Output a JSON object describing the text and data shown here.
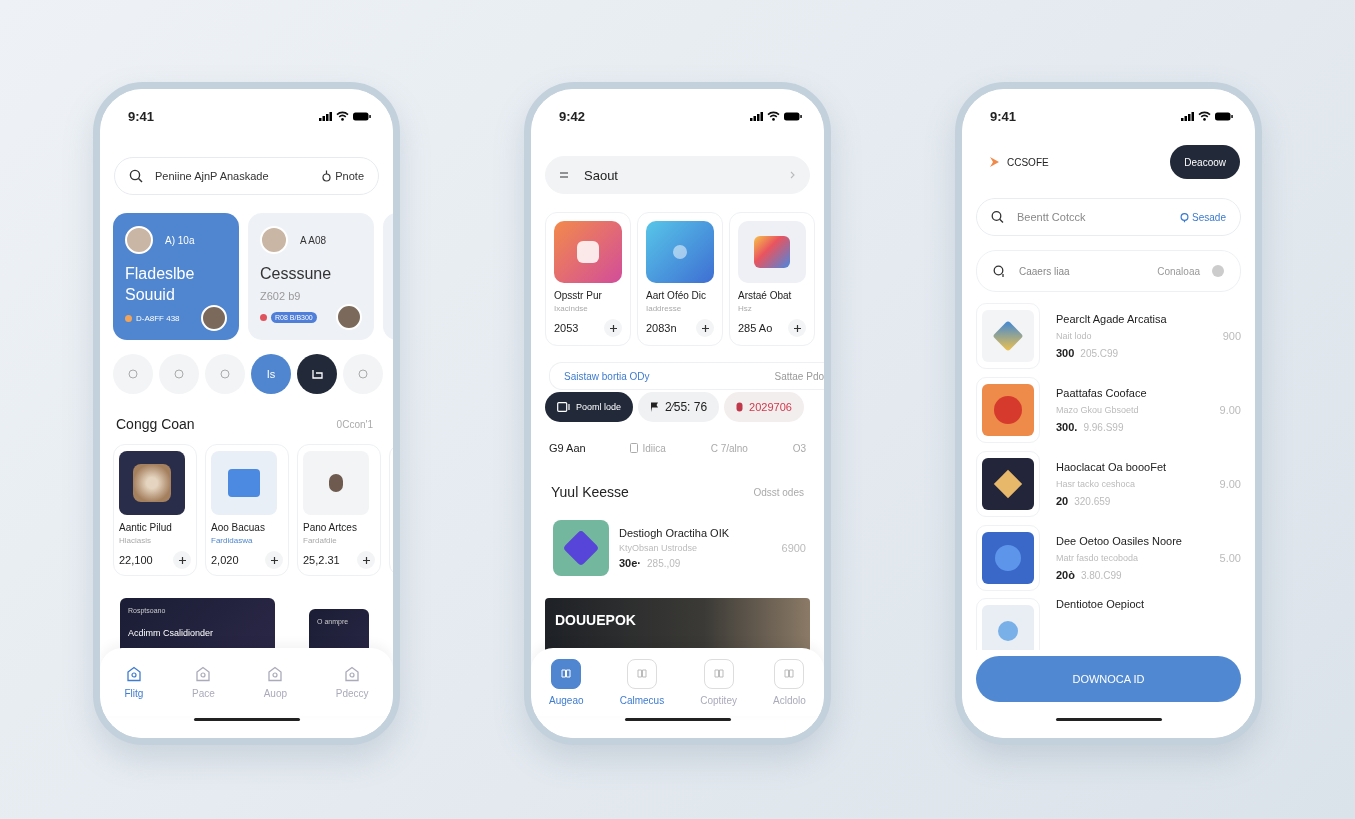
{
  "left_phone": {
    "time": "9:41",
    "search": {
      "placeholder": "Peniine AjnP Anaskade",
      "action": "Pnote"
    },
    "featured": [
      {
        "meta": "A) 10a",
        "title": "Fladeslbe Souuid",
        "footer": "D-A8FF 438",
        "selected": true
      },
      {
        "meta": "A A08",
        "title": "Cesssune",
        "subtitle": "Z602 b9",
        "tag": "R08 B/B300",
        "selected": false
      }
    ],
    "chips": [
      {
        "kind": "plain"
      },
      {
        "kind": "plain"
      },
      {
        "kind": "plain"
      },
      {
        "kind": "accent",
        "label": "Is"
      },
      {
        "kind": "dark"
      },
      {
        "kind": "plain"
      }
    ],
    "section": {
      "title": "Congg Coan",
      "link": "0Ccon'1"
    },
    "products": [
      {
        "name": "Aantic Pilud",
        "subtitle": "Hlaciasis",
        "price": "22,100",
        "highlighted": false
      },
      {
        "name": "Aoo Bacuas",
        "subtitle": "Fardidaswa",
        "price": "2,020",
        "highlighted": true
      },
      {
        "name": "Pano Artces",
        "subtitle": "Fardafdie",
        "price": "25,2.31",
        "highlighted": false
      }
    ],
    "banners": [
      {
        "kicker": "Rosptsoano",
        "title": "Acdimm Csalidionder"
      },
      {
        "kicker": "O anmpre"
      }
    ],
    "nav": [
      {
        "label": "Flitg",
        "selected": true
      },
      {
        "label": "Pace",
        "selected": false
      },
      {
        "label": "Auop",
        "selected": false
      },
      {
        "label": "Pdeccy",
        "selected": false
      }
    ]
  },
  "middle_phone": {
    "time": "9:42",
    "search": {
      "value": "Saout"
    },
    "apps": [
      {
        "name": "Opsstr Pur",
        "subtitle": "Ixacindse",
        "price": "2053"
      },
      {
        "name": "Aart Oféo Dic",
        "subtitle": "Iaddresse",
        "price": "2083n"
      },
      {
        "name": "Arstaé Obat",
        "subtitle": "Hsz",
        "price": "285 Ao"
      }
    ],
    "tabs": [
      {
        "label": "Saistaw bortia ODy",
        "selected": true
      },
      {
        "label": "Sattae Pdo",
        "selected": false
      }
    ],
    "chips": [
      {
        "label": "Pooml lode",
        "kind": "dark"
      },
      {
        "label": "2⁄55: 76",
        "kind": "light"
      },
      {
        "label": "2029706",
        "kind": "alert"
      }
    ],
    "stats": [
      {
        "label": "G9 Aan",
        "kind": "strong"
      },
      {
        "label": "Idiica",
        "kind": "icon"
      },
      {
        "label": "C 7/alno",
        "kind": "plain"
      },
      {
        "label": "O3",
        "kind": "plain"
      }
    ],
    "section": {
      "title": "Yuul Keesse",
      "link": "Odsst odes"
    },
    "item": {
      "title": "Destiogh Oractiha OIK",
      "subtitle": "KtyObsan Ustrodse",
      "count": "30e·",
      "price": "285.,09",
      "amount": "6900"
    },
    "banner": {
      "title": "DOUUEPOK"
    },
    "nav": [
      {
        "label": "Augeao",
        "selected": true,
        "highlighted": false
      },
      {
        "label": "Calmecus",
        "selected": false,
        "highlighted": true
      },
      {
        "label": "Coptitey",
        "selected": false,
        "highlighted": false
      },
      {
        "label": "Acldolo",
        "selected": false,
        "highlighted": false
      }
    ]
  },
  "right_phone": {
    "time": "9:41",
    "brand": "CCSOFE",
    "header_button": "Deacoow",
    "search": {
      "placeholder": "Beentt Cotcck",
      "action": "Sesade"
    },
    "filter": {
      "label": "Caaers liaa",
      "value": "Conaloaa"
    },
    "items": [
      {
        "title": "Pearclt Agade Arcatisa",
        "subtitle": "Nait lodo",
        "count": "300",
        "price": "205.C99",
        "amount": "900"
      },
      {
        "title": "Paattafas Cooface",
        "subtitle": "Mazo Gkou Gbsoetd",
        "count": "300.",
        "price": "9.96.S99",
        "amount": "9.00"
      },
      {
        "title": "Haoclacat Oa boooFet",
        "subtitle": "Hasr tacko ceshoca",
        "count": "20",
        "price": "320.659",
        "amount": "9.00"
      },
      {
        "title": "Dee Oetoo Oasiles Noore",
        "subtitle": "Matr fasdo tecoboda",
        "count": "20ò",
        "price": "3.80.C99",
        "amount": "5.00"
      },
      {
        "title": "Dentiotoe Oepioct"
      }
    ],
    "button": "DOWNOCA ID"
  }
}
